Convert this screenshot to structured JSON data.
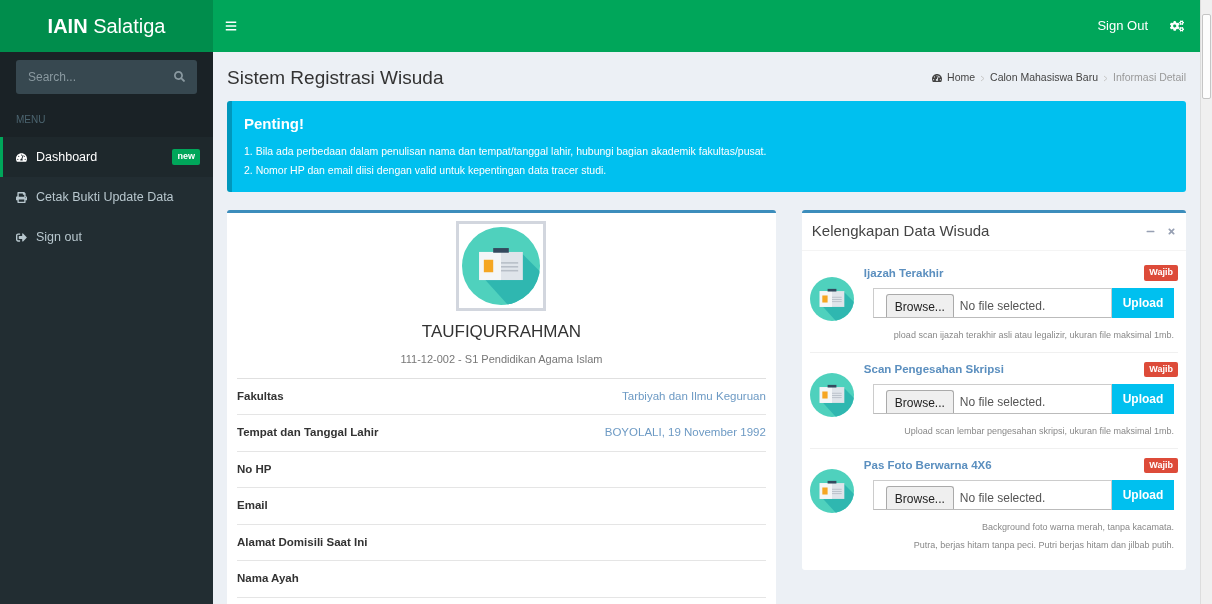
{
  "brand": {
    "bold": "IAIN",
    "rest": "Salatiga"
  },
  "topbar": {
    "sign_out": "Sign Out"
  },
  "sidebar": {
    "search": {
      "placeholder": "Search..."
    },
    "header": "MENU",
    "items": [
      {
        "label": "Dashboard",
        "kind": "dashboard",
        "badge": "new",
        "selected": true
      },
      {
        "label": "Cetak Bukti Update Data",
        "kind": "print",
        "selected": false
      },
      {
        "label": "Sign out",
        "kind": "signout",
        "selected": false
      }
    ]
  },
  "page": {
    "title": "Sistem Registrasi Wisuda",
    "breadcrumb": [
      "Home",
      "Calon Mahasiswa Baru",
      "Informasi Detail"
    ]
  },
  "callout": {
    "title": "Penting!",
    "lines": [
      "1. Bila ada perbedaan dalam penulisan nama dan tempat/tanggal lahir, hubungi bagian akademik fakultas/pusat.",
      "2. Nomor HP dan email diisi dengan valid untuk kepentingan data tracer studi."
    ]
  },
  "profile": {
    "name": "TAUFIQURRAHMAN",
    "subtitle": "111-12-002 - S1 Pendidikan Agama Islam",
    "rows": [
      {
        "label": "Fakultas",
        "value": "Tarbiyah dan Ilmu Keguruan"
      },
      {
        "label": "Tempat dan Tanggal Lahir",
        "value": "BOYOLALI, 19 November 1992"
      },
      {
        "label": "No HP"
      },
      {
        "label": "Email"
      },
      {
        "label": "Alamat Domisili Saat Ini"
      },
      {
        "label": "Nama Ayah"
      }
    ]
  },
  "documents": {
    "title": "Kelengkapan Data Wisuda",
    "items": [
      {
        "title": "Ijazah Terakhir",
        "badge": "Wajib",
        "browse": "Browse...",
        "status": "No file selected.",
        "upload": "Upload",
        "hints": [
          "pload scan ijazah terakhir asli atau legalizir, ukuran file maksimal 1mb."
        ]
      },
      {
        "title": "Scan Pengesahan Skripsi",
        "badge": "Wajib",
        "browse": "Browse...",
        "status": "No file selected.",
        "upload": "Upload",
        "hints": [
          "Upload scan lembar pengesahan skripsi, ukuran file maksimal 1mb."
        ]
      },
      {
        "title": "Pas Foto Berwarna 4X6",
        "badge": "Wajib",
        "browse": "Browse...",
        "status": "No file selected.",
        "upload": "Upload",
        "hints": [
          "Background foto warna merah, tanpa kacamata.",
          "Putra, berjas hitam tanpa peci. Putri berjas hitam dan jilbab putih."
        ]
      }
    ]
  }
}
